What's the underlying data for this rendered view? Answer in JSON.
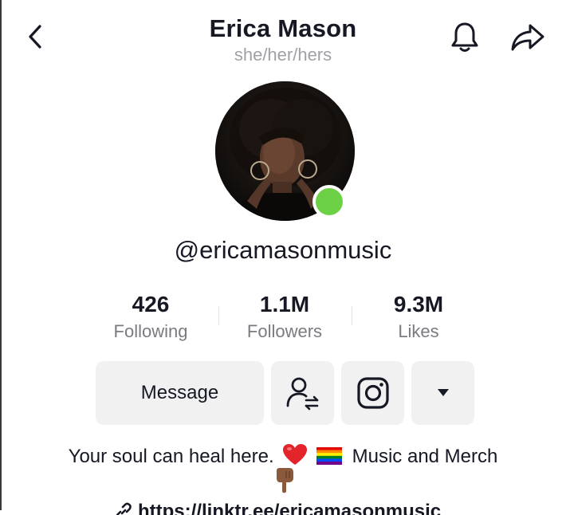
{
  "header": {
    "display_name": "Erica Mason",
    "pronouns": "she/her/hers",
    "back_icon": "chevron-left-icon",
    "notification_icon": "bell-icon",
    "share_icon": "share-arrow-icon"
  },
  "profile": {
    "username": "@ericamasonmusic",
    "online": true,
    "online_color": "#6cd144"
  },
  "stats": [
    {
      "value": "426",
      "label": "Following"
    },
    {
      "value": "1.1M",
      "label": "Followers"
    },
    {
      "value": "9.3M",
      "label": "Likes"
    }
  ],
  "actions": {
    "message_label": "Message",
    "friend_icon": "person-swap-icon",
    "instagram_icon": "instagram-icon",
    "more_icon": "caret-down-icon"
  },
  "bio": {
    "text_before": "Your soul can heal here.",
    "text_after": "Music and Merch",
    "emojis": [
      "red-heart",
      "rainbow-flag",
      "pointing-down-hand"
    ]
  },
  "link": {
    "text": "https://linktr.ee/ericamasonmusic",
    "icon": "link-icon"
  },
  "colors": {
    "text": "#161823",
    "secondary_text": "#7a7b80",
    "button_bg": "#f1f1f2",
    "online_dot": "#6cd144"
  }
}
